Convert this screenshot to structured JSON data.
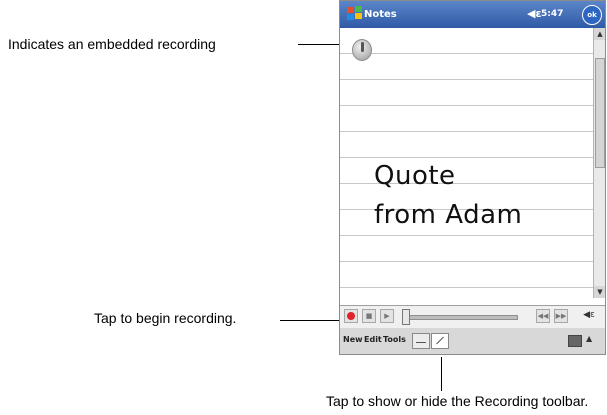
{
  "callouts": {
    "embedded_recording": "Indicates an embedded recording",
    "begin_recording": "Tap to begin recording.",
    "toggle_toolbar": "Tap to show or hide the Recording toolbar."
  },
  "device": {
    "titlebar": {
      "app_name": "Notes",
      "time": "5:47",
      "ok_label": "ok",
      "volume_glyph": "◀ε"
    },
    "note": {
      "lines": [
        "Quote",
        "from Adam"
      ]
    },
    "scrollbar": {
      "up_glyph": "▲",
      "down_glyph": "▼"
    },
    "recording_toolbar": {
      "stop_glyph": "■",
      "play_glyph": "▶",
      "prev_glyph": "◀◀",
      "next_glyph": "▶▶",
      "volume_glyph": "◀ε"
    },
    "menubar": {
      "new": "New",
      "edit": "Edit",
      "tools": "Tools",
      "input_arrow": "▲"
    }
  },
  "colors": {
    "titlebar": "#2f5aa6",
    "record": "#e0232b"
  }
}
